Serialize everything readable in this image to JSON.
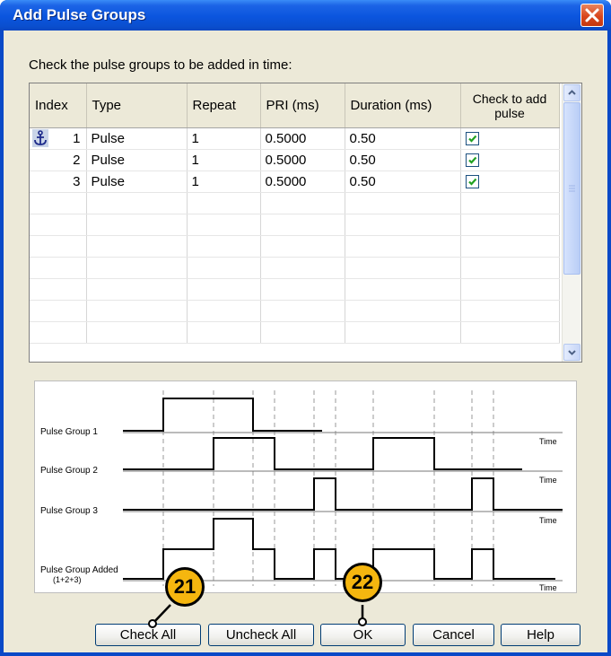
{
  "window": {
    "title": "Add Pulse Groups"
  },
  "instruction": "Check the pulse groups to be added in time:",
  "table": {
    "columns": [
      "Index",
      "Type",
      "Repeat",
      "PRI (ms)",
      "Duration (ms)",
      "Check to add pulse"
    ],
    "rows": [
      {
        "index": "1",
        "type": "Pulse",
        "repeat": "1",
        "pri": "0.5000",
        "duration": "0.50",
        "checked": true
      },
      {
        "index": "2",
        "type": "Pulse",
        "repeat": "1",
        "pri": "0.5000",
        "duration": "0.50",
        "checked": true
      },
      {
        "index": "3",
        "type": "Pulse",
        "repeat": "1",
        "pri": "0.5000",
        "duration": "0.50",
        "checked": true
      }
    ]
  },
  "diagram": {
    "labels": {
      "group1": "Pulse Group 1",
      "group2": "Pulse Group 2",
      "group3": "Pulse Group 3",
      "added": "Pulse Group Added",
      "added_sub": "(1+2+3)",
      "time": "Time"
    }
  },
  "buttons": {
    "check_all": "Check All",
    "uncheck_all": "Uncheck All",
    "ok": "OK",
    "cancel": "Cancel",
    "help": "Help"
  },
  "callouts": {
    "check_all": "21",
    "ok": "22"
  },
  "colors": {
    "titlebar": "#0b55de",
    "callout": "#f5b60f",
    "close": "#d9471e",
    "check": "#21a121"
  },
  "icons": {
    "close": "close-icon",
    "anchor": "anchor-icon",
    "checkbox": "checkbox-icon"
  }
}
